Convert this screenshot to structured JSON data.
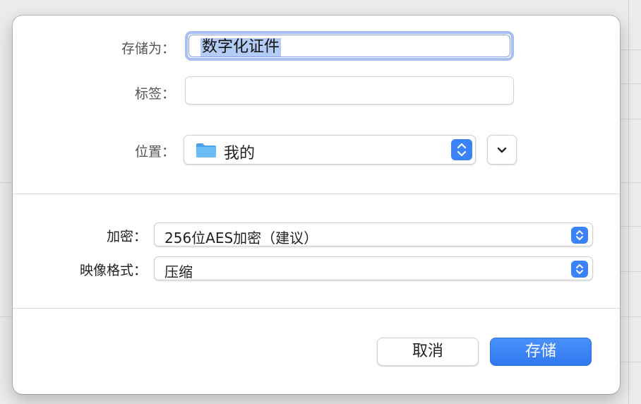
{
  "save_as": {
    "label": "存储为：",
    "value": "数字化证件"
  },
  "tags": {
    "label": "标签：",
    "value": ""
  },
  "location": {
    "label": "位置：",
    "value": "我的",
    "icon": "folder-icon"
  },
  "encryption": {
    "label": "加密：",
    "value": "256位AES加密（建议）"
  },
  "image_format": {
    "label": "映像格式：",
    "value": "压缩"
  },
  "buttons": {
    "cancel": "取消",
    "save": "存储"
  },
  "colors": {
    "accent": "#3a82f7",
    "folder": "#5fb2f0"
  }
}
